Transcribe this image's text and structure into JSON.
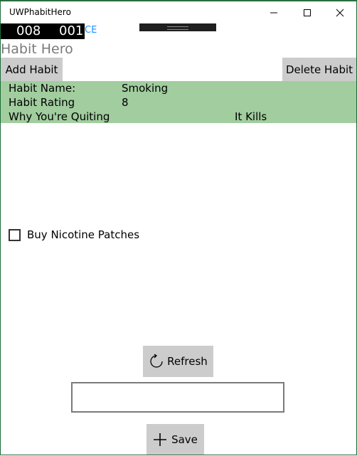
{
  "window": {
    "title": "UWPhabitHero"
  },
  "header": {
    "counter_left": "008",
    "counter_right": "001",
    "counter_suffix": "CE"
  },
  "app": {
    "title": "Habit Hero"
  },
  "toolbar": {
    "add_label": "Add Habit",
    "delete_label": "Delete Habit"
  },
  "habit": {
    "name_label": "Habit Name:",
    "name_value": "Smoking",
    "rating_label": "Habit Rating",
    "rating_value": "8",
    "reason_label": "Why You're Quiting",
    "reason_value": "It Kills"
  },
  "task": {
    "label": "Buy Nicotine Patches",
    "checked": false
  },
  "actions": {
    "refresh_label": "Refresh",
    "input_value": "",
    "save_label": "Save"
  },
  "icons": {
    "minimize": "minimize-icon",
    "maximize": "maximize-icon",
    "close": "close-icon",
    "refresh": "refresh-icon",
    "save": "plus-icon"
  },
  "colors": {
    "habit_panel": "#a1cd9f",
    "button_bg": "#cccccc",
    "counter_bg": "#000000",
    "suffix_text": "#1e90ff"
  }
}
